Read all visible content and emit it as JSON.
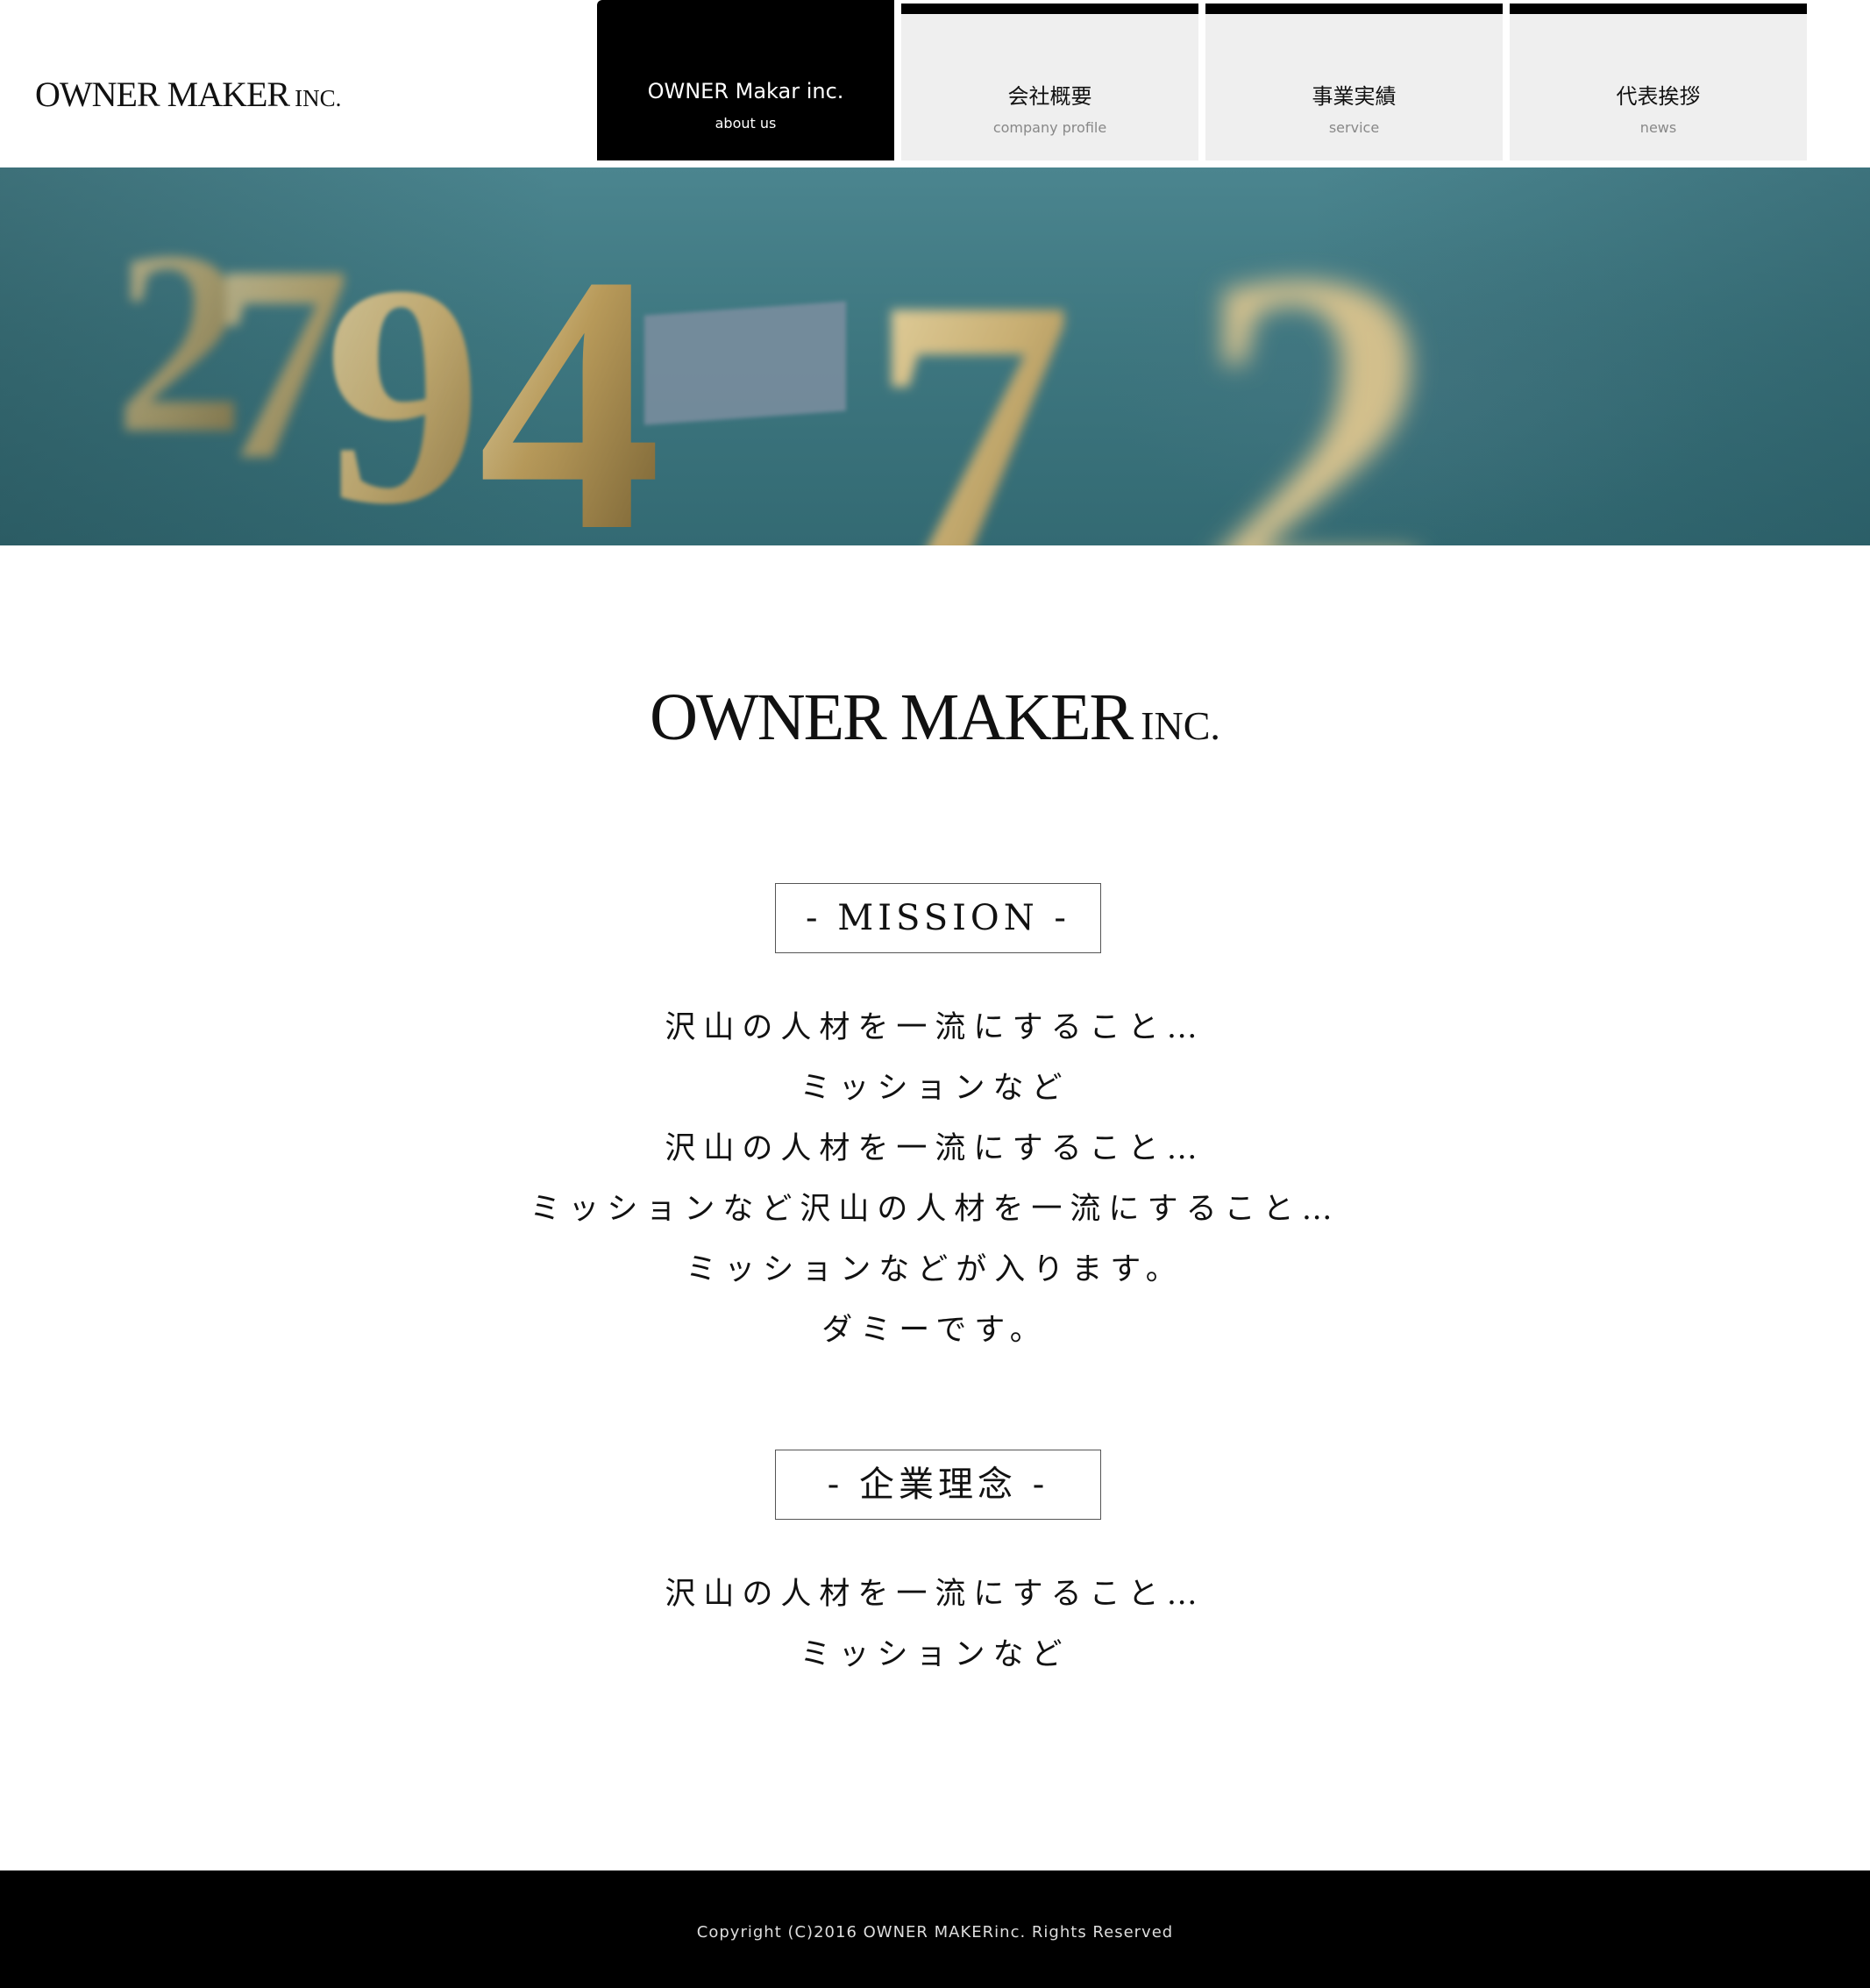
{
  "header": {
    "logo": {
      "main": "OWNER MAKER",
      "suffix": "INC."
    },
    "nav": [
      {
        "label": "OWNER Makar inc.",
        "sublabel": "about us",
        "active": true
      },
      {
        "label": "会社概要",
        "sublabel": "company profile",
        "active": false
      },
      {
        "label": "事業実績",
        "sublabel": "service",
        "active": false
      },
      {
        "label": "代表挨拶",
        "sublabel": "news",
        "active": false
      }
    ]
  },
  "hero": {
    "image": "brass house numbers 2794-72 on teal wall"
  },
  "main": {
    "logo": {
      "main": "OWNER MAKER",
      "suffix": "INC."
    },
    "mission": {
      "heading": "- MISSION -",
      "lines": [
        "沢山の人材を一流にすること…",
        "ミッションなど",
        "沢山の人材を一流にすること…",
        "ミッションなど沢山の人材を一流にすること…",
        "ミッションなどが入ります。",
        "ダミーです。"
      ]
    },
    "philosophy": {
      "heading": "- 企業理念 -",
      "lines": [
        "沢山の人材を一流にすること…",
        "ミッションなど"
      ]
    }
  },
  "footer": {
    "copyright": "Copyright (C)2016 OWNER MAKERinc. Rights Reserved"
  },
  "colors": {
    "nav_active_bg": "#000000",
    "nav_inactive_bg": "#efefef",
    "footer_bg": "#000000",
    "hero_teal": "#3e7780",
    "brass": "#c9b27a"
  }
}
